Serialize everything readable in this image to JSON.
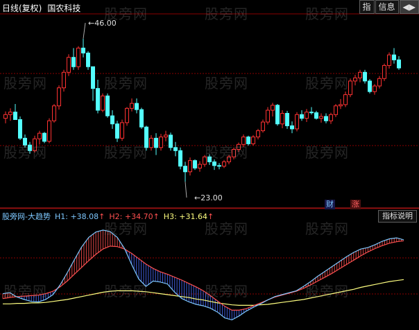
{
  "header": {
    "period": "日线(复权)",
    "stock_name": "国农科技",
    "buttons": [
      "指",
      "信息",
      "◀▶"
    ]
  },
  "price_panel": {
    "high_label": "46.00",
    "low_label": "23.00",
    "badge_cai": "财",
    "badge_zhang": "涨",
    "colors": {
      "up": "#ff3232",
      "down": "#54ffff",
      "grid": "#8b0000",
      "border": "#8b0000"
    }
  },
  "indicator_panel": {
    "title": "股旁网-大趋势",
    "h1": "H1: +38.08",
    "h1_arrow": "↑",
    "h2": "H2: +34.70",
    "h2_arrow": "↑",
    "h3": "H3: +31.64",
    "h3_arrow": "↑",
    "button": "指标说明",
    "colors": {
      "h1": "#7ec8ff",
      "h2": "#ff5050",
      "h3": "#ffff80"
    }
  },
  "watermark": "股旁网",
  "chart_data": [
    {
      "type": "candlestick",
      "title": "国农科技 日线(复权)",
      "annotations": [
        {
          "label": "46.00",
          "kind": "high"
        },
        {
          "label": "23.00",
          "kind": "low"
        }
      ],
      "ylim": [
        19,
        50
      ],
      "candles": [
        [
          33.2,
          34.3,
          32.4,
          33.8
        ],
        [
          33.8,
          34.8,
          32.8,
          34.2
        ],
        [
          34.2,
          35.5,
          33.5,
          33.0
        ],
        [
          33.0,
          33.5,
          29.7,
          30.0
        ],
        [
          30.0,
          30.6,
          28.5,
          28.9
        ],
        [
          28.9,
          29.4,
          27.5,
          28.0
        ],
        [
          28.0,
          30.4,
          27.7,
          29.9
        ],
        [
          29.9,
          31.2,
          29.0,
          30.8
        ],
        [
          30.8,
          31.0,
          29.2,
          29.5
        ],
        [
          29.5,
          33.2,
          29.2,
          32.8
        ],
        [
          32.8,
          35.5,
          32.5,
          35.2
        ],
        [
          35.2,
          38.5,
          34.6,
          38.1
        ],
        [
          38.1,
          41.0,
          37.5,
          40.6
        ],
        [
          40.6,
          43.5,
          40.0,
          43.0
        ],
        [
          43.0,
          44.5,
          41.0,
          41.5
        ],
        [
          41.5,
          44.8,
          41.0,
          44.5
        ],
        [
          44.5,
          46.0,
          43.0,
          43.7
        ],
        [
          43.7,
          44.0,
          41.0,
          41.5
        ],
        [
          41.5,
          40.8,
          36.0,
          38.0
        ],
        [
          38.0,
          39.4,
          34.0,
          34.5
        ],
        [
          34.5,
          37.2,
          34.2,
          36.8
        ],
        [
          36.8,
          37.2,
          33.3,
          33.6
        ],
        [
          33.6,
          34.5,
          31.5,
          32.3
        ],
        [
          32.3,
          32.8,
          29.4,
          30.0
        ],
        [
          30.0,
          33.0,
          29.6,
          32.5
        ],
        [
          32.5,
          35.0,
          32.0,
          34.8
        ],
        [
          34.8,
          36.4,
          34.3,
          35.6
        ],
        [
          35.6,
          36.4,
          34.0,
          34.6
        ],
        [
          34.6,
          34.9,
          31.5,
          31.8
        ],
        [
          31.8,
          32.0,
          28.0,
          28.5
        ],
        [
          28.5,
          30.5,
          28.0,
          30.0
        ],
        [
          30.0,
          30.8,
          27.3,
          28.5
        ],
        [
          28.5,
          30.7,
          28.0,
          30.2
        ],
        [
          30.2,
          31.2,
          29.5,
          30.5
        ],
        [
          30.5,
          30.9,
          28.0,
          28.5
        ],
        [
          28.5,
          29.4,
          27.1,
          28.0
        ],
        [
          28.0,
          28.5,
          25.0,
          25.5
        ],
        [
          25.5,
          26.2,
          23.0,
          24.6
        ],
        [
          24.6,
          26.9,
          24.0,
          26.4
        ],
        [
          26.4,
          26.6,
          24.9,
          25.2
        ],
        [
          25.2,
          26.3,
          24.6,
          25.8
        ],
        [
          25.8,
          27.3,
          25.4,
          27.0
        ],
        [
          27.0,
          27.4,
          25.7,
          26.2
        ],
        [
          26.2,
          26.6,
          24.9,
          25.6
        ],
        [
          25.6,
          26.0,
          25.0,
          25.5
        ],
        [
          25.5,
          26.5,
          25.2,
          26.2
        ],
        [
          26.2,
          27.3,
          25.8,
          27.0
        ],
        [
          27.0,
          28.5,
          26.6,
          28.2
        ],
        [
          28.2,
          29.3,
          27.8,
          29.0
        ],
        [
          29.0,
          30.6,
          28.6,
          30.2
        ],
        [
          30.2,
          30.4,
          28.8,
          29.1
        ],
        [
          29.1,
          30.5,
          28.8,
          30.2
        ],
        [
          30.2,
          31.5,
          29.8,
          31.2
        ],
        [
          31.2,
          33.0,
          30.9,
          32.6
        ],
        [
          32.6,
          35.0,
          32.2,
          34.5
        ],
        [
          34.5,
          35.7,
          33.5,
          35.3
        ],
        [
          35.3,
          35.5,
          32.0,
          32.3
        ],
        [
          32.3,
          34.5,
          31.6,
          34.0
        ],
        [
          34.0,
          34.4,
          31.5,
          32.0
        ],
        [
          32.0,
          32.7,
          30.8,
          31.5
        ],
        [
          31.5,
          34.2,
          31.1,
          33.8
        ],
        [
          33.8,
          34.5,
          32.8,
          33.2
        ],
        [
          33.2,
          34.7,
          32.6,
          34.2
        ],
        [
          34.2,
          35.0,
          33.8,
          34.1
        ],
        [
          34.1,
          34.4,
          33.0,
          33.2
        ],
        [
          33.2,
          34.0,
          32.5,
          33.5
        ],
        [
          33.5,
          34.0,
          32.4,
          32.8
        ],
        [
          32.8,
          34.1,
          32.3,
          33.8
        ],
        [
          33.8,
          35.5,
          33.4,
          35.2
        ],
        [
          35.2,
          36.3,
          34.7,
          35.4
        ],
        [
          35.4,
          37.5,
          35.0,
          37.0
        ],
        [
          37.0,
          39.6,
          36.6,
          39.2
        ],
        [
          39.2,
          40.2,
          38.5,
          39.7
        ],
        [
          39.7,
          41.0,
          39.0,
          40.6
        ],
        [
          40.6,
          41.0,
          38.8,
          39.2
        ],
        [
          39.2,
          39.5,
          37.2,
          37.5
        ],
        [
          37.5,
          38.7,
          37.0,
          38.4
        ],
        [
          38.4,
          40.0,
          38.0,
          39.6
        ],
        [
          39.6,
          42.0,
          39.2,
          41.7
        ],
        [
          41.7,
          43.8,
          41.2,
          43.4
        ],
        [
          43.4,
          44.5,
          42.0,
          42.6
        ],
        [
          42.6,
          43.2,
          41.0,
          41.3
        ]
      ]
    },
    {
      "type": "line",
      "title": "股旁网-大趋势",
      "series": [
        {
          "name": "H1",
          "values": [
            31.2,
            31.4,
            30.5,
            30.0,
            29.6,
            29.5,
            30.0,
            31.0,
            33.0,
            35.5,
            38.2,
            40.8,
            42.8,
            43.9,
            44.3,
            44.0,
            42.8,
            40.5,
            37.2,
            34.2,
            32.7,
            33.8,
            33.6,
            33.2,
            31.5,
            30.2,
            29.5,
            29.0,
            28.7,
            28.2,
            27.4,
            26.2,
            25.8,
            26.6,
            27.6,
            28.4,
            29.1,
            29.9,
            30.6,
            31.0,
            31.4,
            31.8,
            32.7,
            33.7,
            34.8,
            35.8,
            36.8,
            37.8,
            38.8,
            39.7,
            40.4,
            40.7,
            41.3,
            42.0,
            42.5,
            42.7,
            42.3
          ]
        },
        {
          "name": "H2",
          "values": [
            30.2,
            30.4,
            30.6,
            30.7,
            30.8,
            30.9,
            31.2,
            31.7,
            32.6,
            33.8,
            35.2,
            36.6,
            38.0,
            39.3,
            40.4,
            41.0,
            40.9,
            40.4,
            39.5,
            38.4,
            37.3,
            36.4,
            35.7,
            35.2,
            34.6,
            34.0,
            33.3,
            32.6,
            31.8,
            30.8,
            29.7,
            28.6,
            27.8,
            27.8,
            28.1,
            28.7,
            29.3,
            29.9,
            30.5,
            30.9,
            31.3,
            31.7,
            32.3,
            33.0,
            33.8,
            34.6,
            35.4,
            36.3,
            37.2,
            38.1,
            39.0,
            39.8,
            40.5,
            41.1,
            41.6,
            41.9,
            42.1
          ]
        },
        {
          "name": "H3",
          "values": [
            29.1,
            29.1,
            29.2,
            29.2,
            29.3,
            29.3,
            29.4,
            29.6,
            29.8,
            30.0,
            30.3,
            30.6,
            30.9,
            31.2,
            31.5,
            31.7,
            31.8,
            31.8,
            31.8,
            31.7,
            31.6,
            31.4,
            31.2,
            31.0,
            30.8,
            30.6,
            30.4,
            30.1,
            29.9,
            29.6,
            29.3,
            29.1,
            28.9,
            28.8,
            28.8,
            28.8,
            28.9,
            29.0,
            29.2,
            29.4,
            29.6,
            29.8,
            30.0,
            30.3,
            30.6,
            30.9,
            31.2,
            31.5,
            31.8,
            32.1,
            32.5,
            32.8,
            33.1,
            33.4,
            33.7,
            33.9,
            34.1
          ]
        }
      ]
    }
  ]
}
